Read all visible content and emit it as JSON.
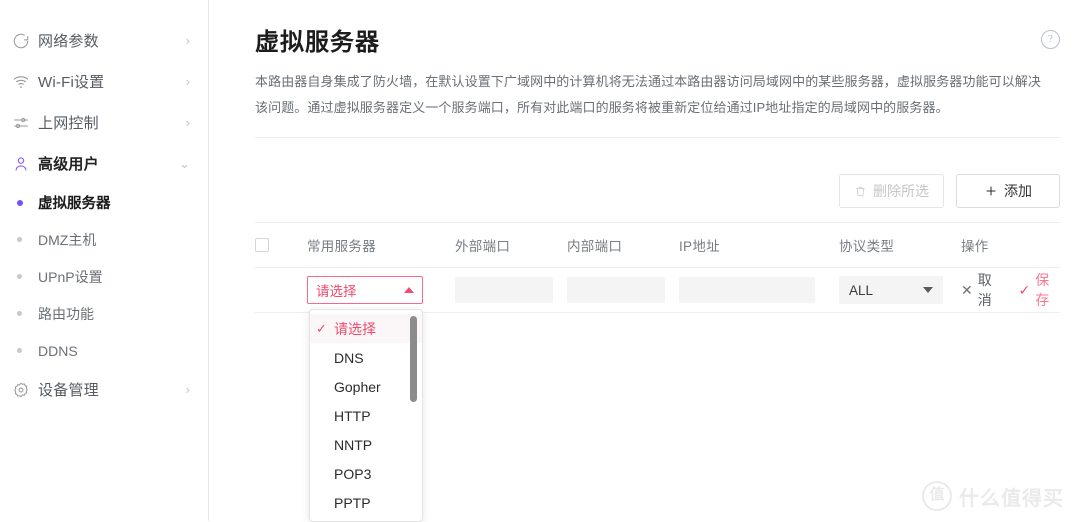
{
  "sidebar": {
    "items": [
      {
        "id": "network",
        "label": "网络参数",
        "icon": "globe-icon",
        "chevron": "›",
        "active": false
      },
      {
        "id": "wifi",
        "label": "Wi-Fi设置",
        "icon": "wifi-icon",
        "chevron": "›",
        "active": false
      },
      {
        "id": "access-control",
        "label": "上网控制",
        "icon": "sliders-icon",
        "chevron": "›",
        "active": false
      },
      {
        "id": "advanced-user",
        "label": "高级用户",
        "icon": "user-icon",
        "chevron": "⌄",
        "active": true
      }
    ],
    "sub_items": [
      {
        "id": "virtual-server",
        "label": "虚拟服务器",
        "active": true
      },
      {
        "id": "dmz-host",
        "label": "DMZ主机",
        "active": false
      },
      {
        "id": "upnp",
        "label": "UPnP设置",
        "active": false
      },
      {
        "id": "routing",
        "label": "路由功能",
        "active": false
      },
      {
        "id": "ddns",
        "label": "DDNS",
        "active": false
      }
    ],
    "footer_item": {
      "id": "device-manage",
      "label": "设备管理",
      "icon": "gear-icon",
      "chevron": "›"
    }
  },
  "page": {
    "title": "虚拟服务器",
    "help_icon": "?",
    "description": "本路由器自身集成了防火墙，在默认设置下广域网中的计算机将无法通过本路由器访问局域网中的某些服务器，虚拟服务器功能可以解决该问题。通过虚拟服务器定义一个服务端口，所有对此端口的服务将被重新定位给通过IP地址指定的局域网中的服务器。"
  },
  "toolbar": {
    "delete_label": "删除所选",
    "delete_icon": "trash-icon",
    "delete_disabled": true,
    "add_label": "添加",
    "add_icon": "plus-icon"
  },
  "table": {
    "columns": [
      "常用服务器",
      "外部端口",
      "内部端口",
      "IP地址",
      "协议类型",
      "操作"
    ],
    "header_checkbox_checked": false,
    "edit_row": {
      "server_select": {
        "value": "请选择",
        "open": true,
        "caret": "up",
        "options": [
          "请选择",
          "DNS",
          "Gopher",
          "HTTP",
          "NNTP",
          "POP3",
          "PPTP"
        ],
        "selected": "请选择",
        "check_glyph": "✓"
      },
      "external_port": {
        "value": "",
        "placeholder": ""
      },
      "internal_port": {
        "value": "",
        "placeholder": ""
      },
      "ip_address": {
        "value": "",
        "placeholder": ""
      },
      "protocol_select": {
        "value": "ALL",
        "caret": "down"
      },
      "actions": [
        {
          "id": "cancel",
          "label": "取消",
          "glyph": "✕",
          "icon": "close-icon"
        },
        {
          "id": "save",
          "label": "保存",
          "glyph": "✓",
          "icon": "check-icon"
        }
      ]
    }
  },
  "watermark": {
    "badge": "值",
    "text": "什么值得买"
  },
  "colors": {
    "accent_pink": "#f24a6d",
    "accent_purple": "#7c4dff",
    "text": "#333333",
    "muted": "#787d83",
    "border": "#eeeeee",
    "field_bg": "#f4f4f4"
  }
}
